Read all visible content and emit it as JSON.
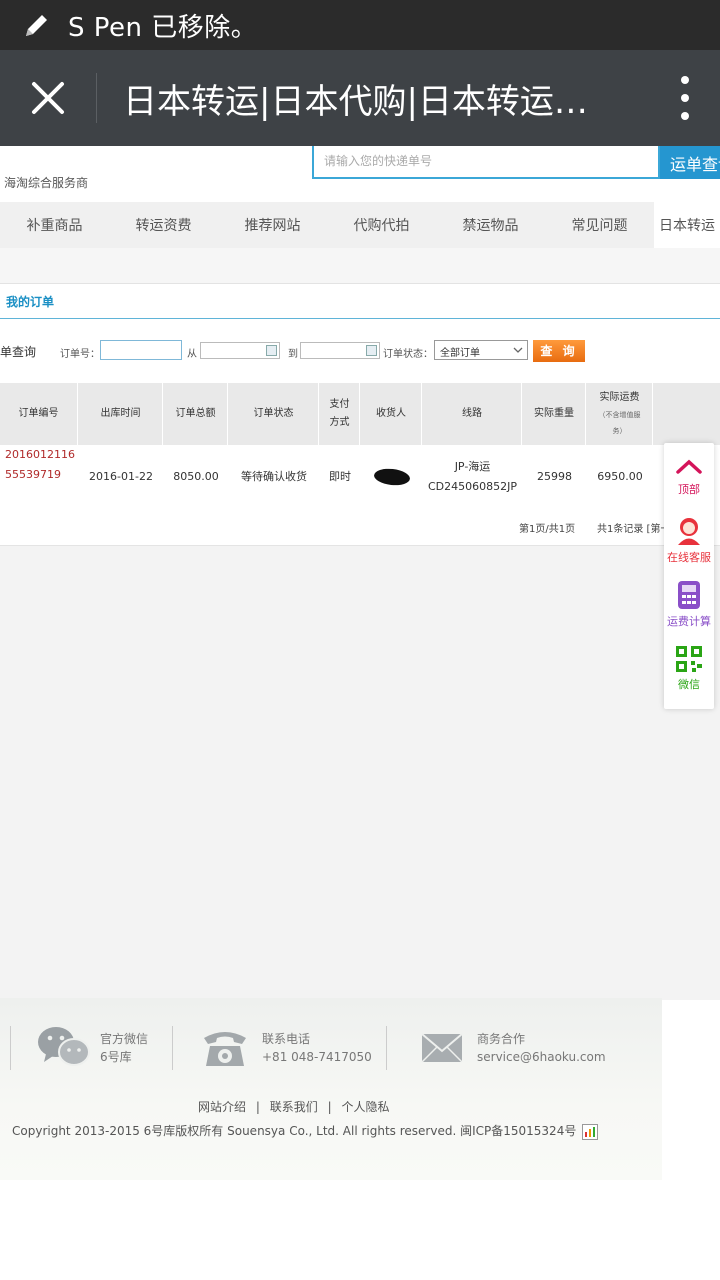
{
  "status_bar": {
    "message": "S Pen 已移除。"
  },
  "browser": {
    "title": "日本转运|日本代购|日本转运公..."
  },
  "header": {
    "tagline": "海淘综合服务商",
    "search_placeholder": "请输入您的快递单号",
    "search_button": "运单查询"
  },
  "nav": {
    "items": [
      {
        "label": "补重商品"
      },
      {
        "label": "转运资费"
      },
      {
        "label": "推荐网站"
      },
      {
        "label": "代购代拍"
      },
      {
        "label": "禁运物品"
      },
      {
        "label": "常见问题"
      },
      {
        "label": "日本转运"
      }
    ]
  },
  "orders": {
    "title": "我的订单",
    "filter": {
      "section_label": "单查询",
      "order_no_label": "订单号：",
      "from_label": "从",
      "to_label": "到",
      "status_label": "订单状态：",
      "status_value": "全部订单",
      "query_button": "查 询"
    },
    "columns": {
      "order_no": "订单编号",
      "ship_time": "出库时间",
      "total": "订单总额",
      "status": "订单状态",
      "payment_1": "支付",
      "payment_2": "方式",
      "receiver": "收货人",
      "route": "线路",
      "weight": "实际重量",
      "fee": "实际运费",
      "fee_note_1": "（不含增值服",
      "fee_note_2": "务）"
    },
    "rows": [
      {
        "order_no_1": "2016012116",
        "order_no_2": "55539719",
        "ship_time": "2016-01-22",
        "total": "8050.00",
        "status": "等待确认收货",
        "payment": "即时",
        "route_1": "JP-海运",
        "route_2": "CD245060852JP",
        "weight": "25998",
        "fee": "6950.00"
      }
    ],
    "pager": {
      "page_info": "第1页/共1页",
      "record_info": "共1条记录 [第一"
    }
  },
  "float_bar": {
    "top": "顶部",
    "service": "在线客服",
    "calc": "运费计算",
    "wechat": "微信",
    "colors": {
      "top": "#d4145a",
      "service": "#e8323c",
      "calc": "#8a4fc8",
      "wechat": "#2aa515"
    }
  },
  "footer": {
    "wechat_label": "官方微信",
    "wechat_value": "6号库",
    "phone_label": "联系电话",
    "phone_value": "+81 048-7417050",
    "biz_label": "商务合作",
    "biz_value": "service@6haoku.com",
    "links": [
      "网站介绍",
      "联系我们",
      "个人隐私"
    ],
    "link_sep": "|",
    "copyright": "Copyright 2013-2015 6号库版权所有 Souensya Co., Ltd. All rights reserved. 闽ICP备15015324号"
  }
}
